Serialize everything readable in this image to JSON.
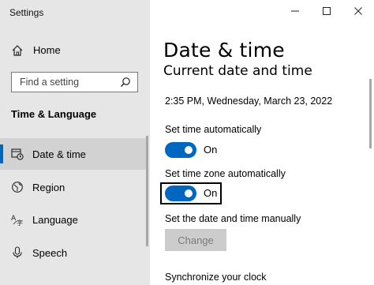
{
  "window": {
    "title": "Settings"
  },
  "sidebar": {
    "home_label": "Home",
    "search_placeholder": "Find a setting",
    "section_heading": "Time & Language",
    "items": [
      {
        "label": "Date & time",
        "icon": "date-time-icon",
        "selected": true
      },
      {
        "label": "Region",
        "icon": "globe-icon",
        "selected": false
      },
      {
        "label": "Language",
        "icon": "language-icon",
        "selected": false
      },
      {
        "label": "Speech",
        "icon": "microphone-icon",
        "selected": false
      }
    ]
  },
  "main": {
    "page_title": "Date & time",
    "section_title": "Current date and time",
    "current_datetime": "2:35 PM, Wednesday, March 23, 2022",
    "set_time_auto": {
      "label": "Set time automatically",
      "state": "On",
      "on": true
    },
    "set_timezone_auto": {
      "label": "Set time zone automatically",
      "state": "On",
      "on": true
    },
    "manual": {
      "label": "Set the date and time manually",
      "button": "Change",
      "enabled": false
    },
    "sync_label": "Synchronize your clock"
  },
  "colors": {
    "accent": "#0067c0",
    "sidebar_bg": "#e6e6e6",
    "selected_bg": "#d2d2d2",
    "disabled_button": "#cccccc"
  }
}
